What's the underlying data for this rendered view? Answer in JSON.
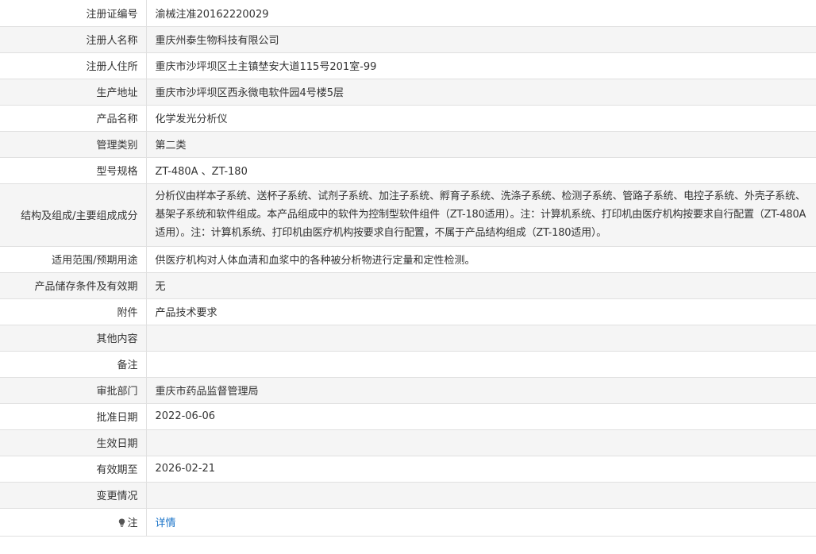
{
  "rows": [
    {
      "label": "注册证编号",
      "value": "渝械注准20162220029"
    },
    {
      "label": "注册人名称",
      "value": "重庆州泰生物科技有限公司"
    },
    {
      "label": "注册人住所",
      "value": "重庆市沙坪坝区土主镇埜安大道115号201室-99"
    },
    {
      "label": "生产地址",
      "value": "重庆市沙坪坝区西永微电软件园4号楼5层"
    },
    {
      "label": "产品名称",
      "value": "化学发光分析仪"
    },
    {
      "label": "管理类别",
      "value": "第二类"
    },
    {
      "label": "型号规格",
      "value": "ZT-480A 、ZT-180"
    },
    {
      "label": "结构及组成/主要组成成分",
      "value": "分析仪由样本子系统、送杯子系统、试剂子系统、加注子系统、孵育子系统、洗涤子系统、检测子系统、管路子系统、电控子系统、外壳子系统、基架子系统和软件组成。本产品组成中的软件为控制型软件组件（ZT-180适用）。注：计算机系统、打印机由医疗机构按要求自行配置（ZT-480A适用）。注：计算机系统、打印机由医疗机构按要求自行配置，不属于产品结构组成（ZT-180适用）。"
    },
    {
      "label": "适用范围/预期用途",
      "value": "供医疗机构对人体血清和血浆中的各种被分析物进行定量和定性检测。"
    },
    {
      "label": "产品储存条件及有效期",
      "value": "无"
    },
    {
      "label": "附件",
      "value": "产品技术要求"
    },
    {
      "label": "其他内容",
      "value": ""
    },
    {
      "label": "备注",
      "value": ""
    },
    {
      "label": "审批部门",
      "value": "重庆市药品监督管理局"
    },
    {
      "label": "批准日期",
      "value": "2022-06-06"
    },
    {
      "label": "生效日期",
      "value": ""
    },
    {
      "label": "有效期至",
      "value": "2026-02-21"
    },
    {
      "label": "变更情况",
      "value": ""
    }
  ],
  "note": {
    "label": "注",
    "icon": "lightbulb-icon",
    "link_text": "详情"
  },
  "colors": {
    "link": "#1a73c8",
    "alt_row": "#f5f5f5",
    "border": "#e0e0e0",
    "text": "#333333"
  }
}
